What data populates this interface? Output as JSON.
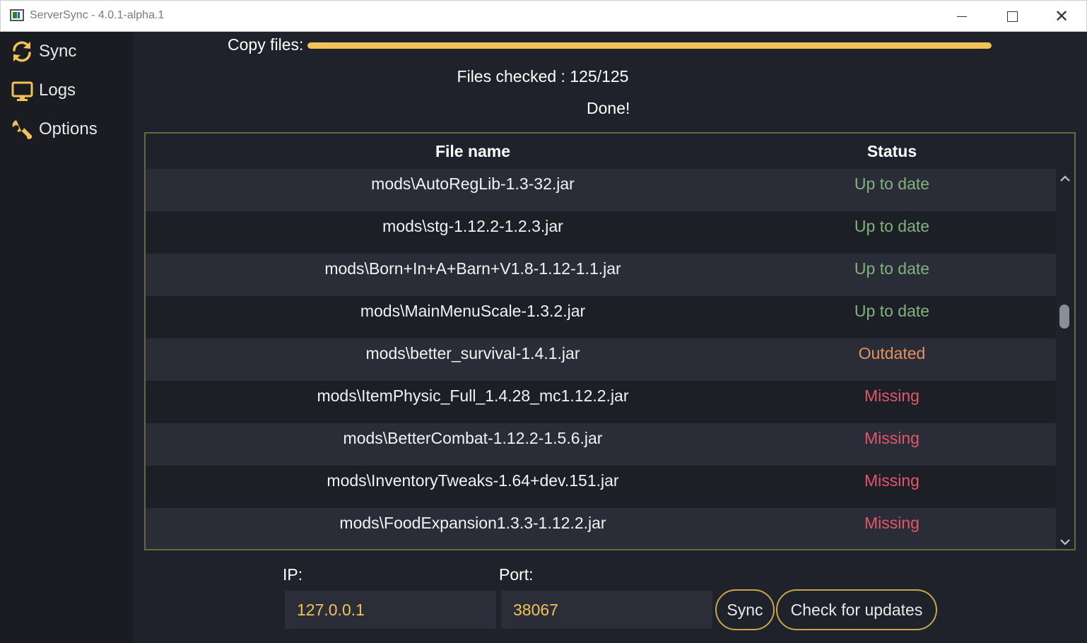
{
  "window": {
    "title": "ServerSync - 4.0.1-alpha.1",
    "controls": [
      "minimize",
      "maximize",
      "close"
    ]
  },
  "sidebar": {
    "items": [
      {
        "label": "Sync",
        "icon": "sync-icon"
      },
      {
        "label": "Logs",
        "icon": "monitor-icon"
      },
      {
        "label": "Options",
        "icon": "wrench-icon"
      }
    ]
  },
  "progress": {
    "label": "Copy files:",
    "fraction": 1.0
  },
  "status": {
    "files_checked": "Files checked : 125/125",
    "message": "Done!"
  },
  "table": {
    "columns": [
      "File name",
      "Status"
    ],
    "rows": [
      {
        "name": "mods\\AutoRegLib-1.3-32.jar",
        "status": "Up to date"
      },
      {
        "name": "mods\\stg-1.12.2-1.2.3.jar",
        "status": "Up to date"
      },
      {
        "name": "mods\\Born+In+A+Barn+V1.8-1.12-1.1.jar",
        "status": "Up to date"
      },
      {
        "name": "mods\\MainMenuScale-1.3.2.jar",
        "status": "Up to date"
      },
      {
        "name": "mods\\better_survival-1.4.1.jar",
        "status": "Outdated"
      },
      {
        "name": "mods\\ItemPhysic_Full_1.4.28_mc1.12.2.jar",
        "status": "Missing"
      },
      {
        "name": "mods\\BetterCombat-1.12.2-1.5.6.jar",
        "status": "Missing"
      },
      {
        "name": "mods\\InventoryTweaks-1.64+dev.151.jar",
        "status": "Missing"
      },
      {
        "name": "mods\\FoodExpansion1.3.3-1.12.2.jar",
        "status": "Missing"
      }
    ]
  },
  "status_colors": {
    "Up to date": "#7fb37a",
    "Outdated": "#e2945a",
    "Missing": "#e2566a"
  },
  "connection": {
    "ip_label": "IP:",
    "ip_value": "127.0.0.1",
    "port_label": "Port:",
    "port_value": "38067"
  },
  "actions": {
    "sync_label": "Sync",
    "updates_label": "Check for updates"
  },
  "colors": {
    "accent": "#f0c257",
    "background": "#1f222a",
    "sidebar": "#1a1c22"
  }
}
